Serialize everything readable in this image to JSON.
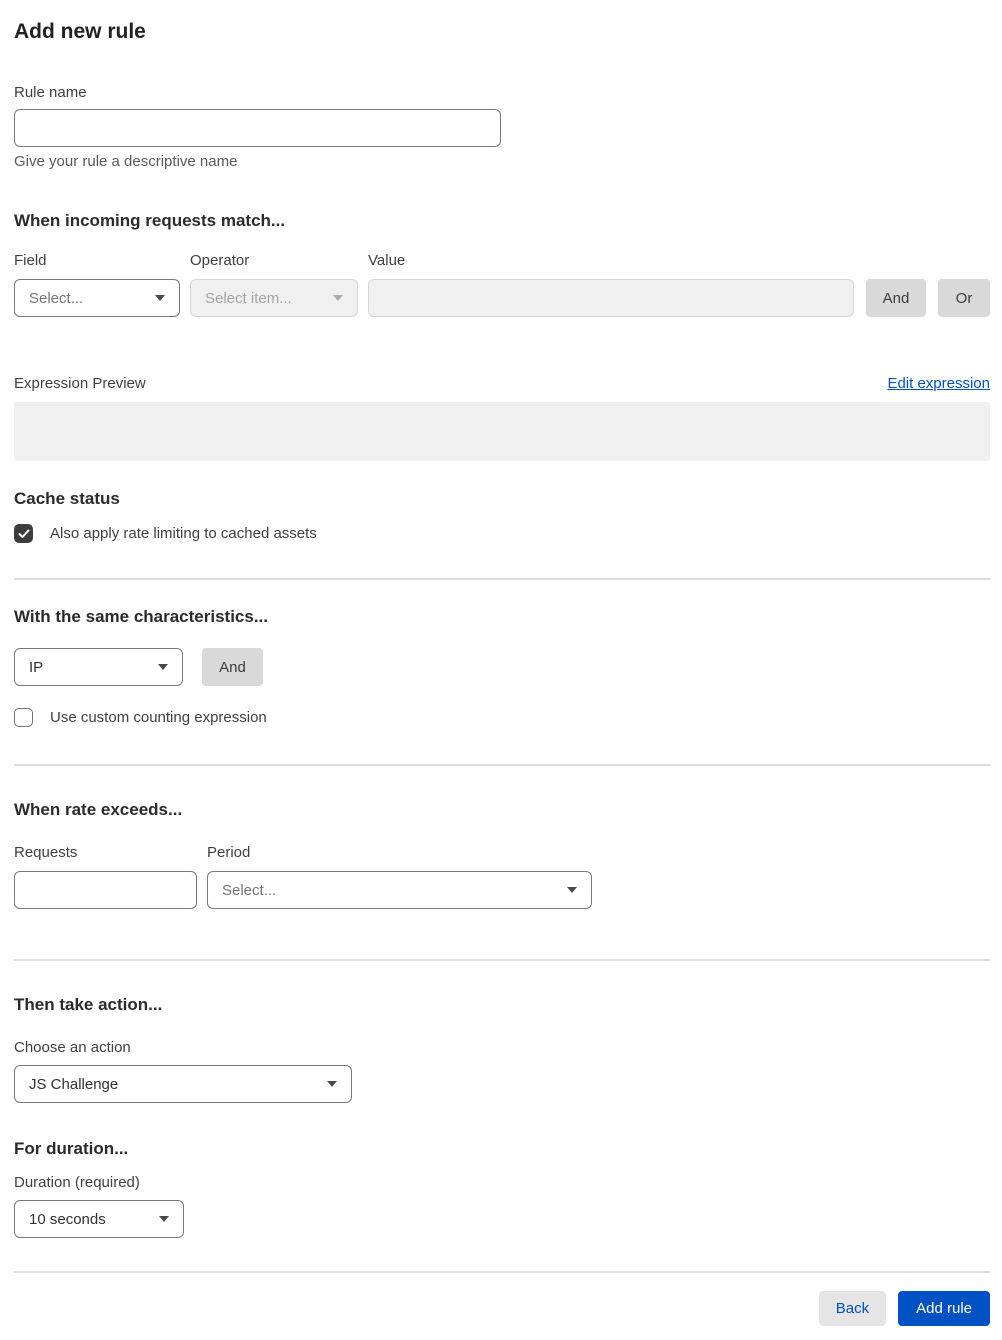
{
  "page": {
    "title": "Add new rule"
  },
  "rule_name": {
    "label": "Rule name",
    "value": "",
    "helper": "Give your rule a descriptive name"
  },
  "match": {
    "heading": "When incoming requests match...",
    "field": {
      "label": "Field",
      "selected": "Select..."
    },
    "operator": {
      "label": "Operator",
      "selected": "Select item...",
      "disabled": true
    },
    "value": {
      "label": "Value",
      "value": "",
      "disabled": true
    },
    "and_label": "And",
    "or_label": "Or",
    "preview": {
      "label": "Expression Preview",
      "edit_link": "Edit expression",
      "content": ""
    }
  },
  "cache": {
    "heading": "Cache status",
    "checkbox_label": "Also apply rate limiting to cached assets",
    "checked": true
  },
  "characteristics": {
    "heading": "With the same characteristics...",
    "selected": "IP",
    "and_label": "And",
    "counting_label": "Use custom counting expression",
    "counting_checked": false
  },
  "rate": {
    "heading": "When rate exceeds...",
    "requests": {
      "label": "Requests",
      "value": ""
    },
    "period": {
      "label": "Period",
      "placeholder": "Select..."
    }
  },
  "action": {
    "heading": "Then take action...",
    "label": "Choose an action",
    "selected": "JS Challenge"
  },
  "duration": {
    "heading": "For duration...",
    "label": "Duration (required)",
    "selected": "10 seconds"
  },
  "footer": {
    "back_label": "Back",
    "add_rule_label": "Add rule"
  },
  "colors": {
    "accent_blue": "#0051c3",
    "checkbox_checked": "#3d3d3d",
    "disabled_bg": "#f0f0f0",
    "preview_bg": "#f0f0f0",
    "gray_button_bg": "#d9d9d9",
    "back_button_bg": "#e5e5e5",
    "divider": "#dedede"
  }
}
